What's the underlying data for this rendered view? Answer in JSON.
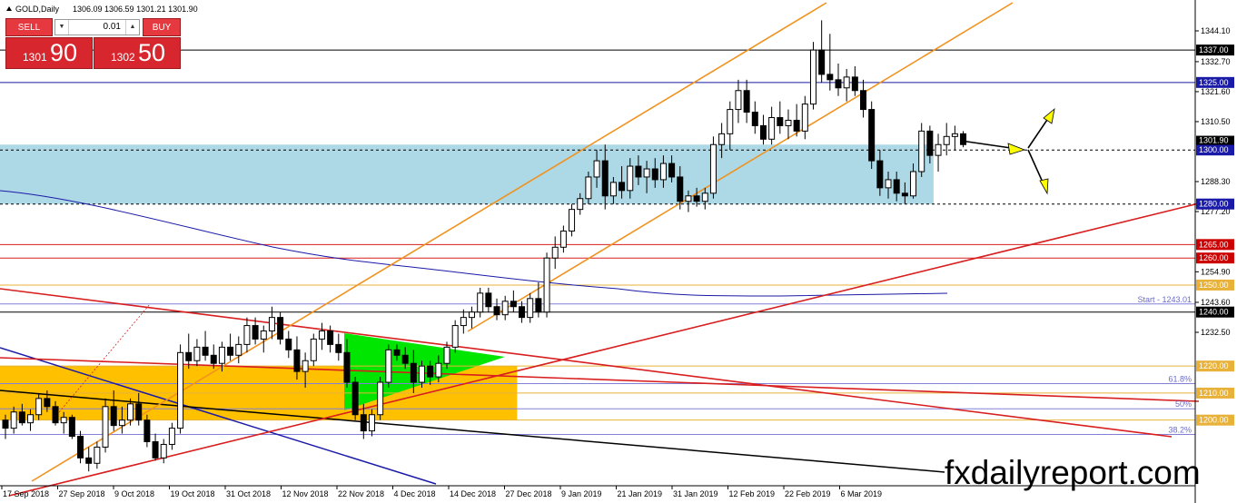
{
  "header": {
    "symbol_timeframe": "GOLD,Daily",
    "ohlc": "1306.09 1306.59 1301.21 1301.90"
  },
  "trade_panel": {
    "sell_label": "SELL",
    "buy_label": "BUY",
    "lot_size": "0.01",
    "sell_price_small": "1301",
    "sell_price_big": "90",
    "buy_price_small": "1302",
    "buy_price_big": "50",
    "button_color": "#e6393f"
  },
  "watermark": "fxdailyreport.com",
  "chart_data": {
    "type": "candlestick",
    "ylim": [
      1190,
      1350
    ],
    "y_ticks": [
      {
        "value": 1344.1,
        "label": "1344.10"
      },
      {
        "value": 1332.7,
        "label": "1332.70"
      },
      {
        "value": 1321.6,
        "label": "1321.60"
      },
      {
        "value": 1310.5,
        "label": "1310.50"
      },
      {
        "value": 1288.3,
        "label": "1288.30"
      },
      {
        "value": 1277.2,
        "label": "1277.20"
      },
      {
        "value": 1254.9,
        "label": "1254.90"
      },
      {
        "value": 1243.6,
        "label": "1243.60"
      },
      {
        "value": 1232.5,
        "label": "1232.50"
      }
    ],
    "x_ticks": [
      "17 Sep 2018",
      "27 Sep 2018",
      "9 Oct 2018",
      "19 Oct 2018",
      "31 Oct 2018",
      "12 Nov 2018",
      "22 Nov 2018",
      "4 Dec 2018",
      "14 Dec 2018",
      "27 Dec 2018",
      "9 Jan 2019",
      "21 Jan 2019",
      "31 Jan 2019",
      "12 Feb 2019",
      "22 Feb 2019",
      "6 Mar 2019"
    ],
    "level_lines": [
      {
        "price": 1337.0,
        "label": "1337.00",
        "style": "solid",
        "color": "#000000",
        "label_bg": "#000000"
      },
      {
        "price": 1325.0,
        "label": "1325.00",
        "style": "solid",
        "color": "#1a1aa8",
        "label_bg": "#1a1aa8"
      },
      {
        "price": 1300.0,
        "label": "1300.00",
        "style": "dashed",
        "color": "#000000",
        "label_bg": "#1a1aa8"
      },
      {
        "price": 1280.0,
        "label": "1280.00",
        "style": "dashed",
        "color": "#000000",
        "label_bg": "#1a1aa8"
      },
      {
        "price": 1265.0,
        "label": "1265.00",
        "style": "solid",
        "color": "#d81e1e",
        "label_bg": "#cc0000"
      },
      {
        "price": 1260.0,
        "label": "1260.00",
        "style": "solid",
        "color": "#d81e1e",
        "label_bg": "#cc0000"
      },
      {
        "price": 1250.0,
        "label": "1250.00",
        "style": "solid",
        "color": "#e8b23a",
        "label_bg": "#e8b23a"
      },
      {
        "price": 1240.0,
        "label": "1240.00",
        "style": "solid",
        "color": "#000000",
        "label_bg": "#000000"
      },
      {
        "price": 1220.0,
        "label": "1220.00",
        "style": "solid",
        "color": "#e8b23a",
        "label_bg": "#e8b23a"
      },
      {
        "price": 1210.0,
        "label": "1210.00",
        "style": "solid",
        "color": "#e8b23a",
        "label_bg": "#e8b23a"
      },
      {
        "price": 1200.0,
        "label": "1200.00",
        "style": "solid",
        "color": "#e8b23a",
        "label_bg": "#e8b23a"
      }
    ],
    "fib_labels": [
      {
        "price": 1243.0,
        "label": "Start - 1243.01"
      },
      {
        "price": 1213.5,
        "label": "61.8%"
      },
      {
        "price": 1204.2,
        "label": "50%"
      },
      {
        "price": 1194.7,
        "label": "38.2%"
      }
    ],
    "current_price": {
      "value": 1301.9,
      "label": "1301.90"
    },
    "zones": [
      {
        "color": "#add8e6",
        "x_start": 0,
        "x_end": 111,
        "y_low": 1280,
        "y_high": 1302
      },
      {
        "color": "#ffc000",
        "x_start": 0,
        "x_end": 61,
        "y_low": 1200,
        "y_high": 1220
      }
    ],
    "candles": [
      [
        1200,
        1202,
        1193,
        1197
      ],
      [
        1197,
        1205,
        1195,
        1203
      ],
      [
        1203,
        1206,
        1198,
        1199
      ],
      [
        1199,
        1204,
        1196,
        1202
      ],
      [
        1202,
        1210,
        1200,
        1208
      ],
      [
        1208,
        1211,
        1203,
        1205
      ],
      [
        1205,
        1207,
        1198,
        1199
      ],
      [
        1199,
        1203,
        1195,
        1201
      ],
      [
        1201,
        1202,
        1193,
        1194
      ],
      [
        1194,
        1196,
        1184,
        1186
      ],
      [
        1186,
        1190,
        1181,
        1184
      ],
      [
        1184,
        1192,
        1182,
        1190
      ],
      [
        1190,
        1208,
        1188,
        1205
      ],
      [
        1205,
        1211,
        1196,
        1198
      ],
      [
        1198,
        1205,
        1195,
        1200
      ],
      [
        1200,
        1208,
        1198,
        1206
      ],
      [
        1206,
        1210,
        1198,
        1200
      ],
      [
        1200,
        1202,
        1190,
        1192
      ],
      [
        1192,
        1195,
        1185,
        1186
      ],
      [
        1186,
        1193,
        1184,
        1191
      ],
      [
        1191,
        1199,
        1189,
        1197
      ],
      [
        1197,
        1228,
        1195,
        1225
      ],
      [
        1225,
        1232,
        1219,
        1222
      ],
      [
        1222,
        1230,
        1220,
        1227
      ],
      [
        1227,
        1233,
        1222,
        1224
      ],
      [
        1224,
        1228,
        1219,
        1221
      ],
      [
        1221,
        1229,
        1218,
        1227
      ],
      [
        1227,
        1232,
        1222,
        1224
      ],
      [
        1224,
        1231,
        1221,
        1228
      ],
      [
        1228,
        1238,
        1225,
        1235
      ],
      [
        1235,
        1238,
        1228,
        1230
      ],
      [
        1230,
        1235,
        1225,
        1233
      ],
      [
        1233,
        1242,
        1230,
        1238
      ],
      [
        1238,
        1240,
        1228,
        1230
      ],
      [
        1230,
        1233,
        1223,
        1226
      ],
      [
        1226,
        1231,
        1215,
        1218
      ],
      [
        1218,
        1225,
        1212,
        1222
      ],
      [
        1222,
        1232,
        1220,
        1230
      ],
      [
        1230,
        1236,
        1226,
        1233
      ],
      [
        1233,
        1235,
        1225,
        1228
      ],
      [
        1228,
        1232,
        1222,
        1225
      ],
      [
        1225,
        1230,
        1212,
        1214
      ],
      [
        1214,
        1216,
        1200,
        1202
      ],
      [
        1202,
        1206,
        1193,
        1196
      ],
      [
        1196,
        1204,
        1194,
        1202
      ],
      [
        1202,
        1216,
        1200,
        1214
      ],
      [
        1214,
        1228,
        1212,
        1226
      ],
      [
        1226,
        1228,
        1222,
        1224
      ],
      [
        1224,
        1227,
        1219,
        1221
      ],
      [
        1221,
        1226,
        1210,
        1214
      ],
      [
        1214,
        1222,
        1212,
        1220
      ],
      [
        1220,
        1222,
        1213,
        1216
      ],
      [
        1216,
        1224,
        1214,
        1221
      ],
      [
        1221,
        1229,
        1219,
        1227
      ],
      [
        1227,
        1237,
        1225,
        1235
      ],
      [
        1235,
        1241,
        1232,
        1238
      ],
      [
        1238,
        1242,
        1234,
        1240
      ],
      [
        1240,
        1249,
        1238,
        1247
      ],
      [
        1247,
        1249,
        1240,
        1242
      ],
      [
        1242,
        1245,
        1237,
        1239
      ],
      [
        1239,
        1246,
        1237,
        1244
      ],
      [
        1244,
        1248,
        1240,
        1242
      ],
      [
        1242,
        1244,
        1236,
        1238
      ],
      [
        1238,
        1247,
        1236,
        1245
      ],
      [
        1245,
        1251,
        1238,
        1240
      ],
      [
        1240,
        1262,
        1238,
        1260
      ],
      [
        1260,
        1268,
        1256,
        1264
      ],
      [
        1264,
        1272,
        1262,
        1270
      ],
      [
        1270,
        1280,
        1268,
        1278
      ],
      [
        1278,
        1284,
        1276,
        1282
      ],
      [
        1282,
        1292,
        1280,
        1290
      ],
      [
        1290,
        1300,
        1286,
        1296
      ],
      [
        1296,
        1302,
        1278,
        1283
      ],
      [
        1283,
        1290,
        1280,
        1288
      ],
      [
        1288,
        1294,
        1282,
        1285
      ],
      [
        1285,
        1297,
        1282,
        1294
      ],
      [
        1294,
        1298,
        1287,
        1290
      ],
      [
        1290,
        1296,
        1284,
        1293
      ],
      [
        1293,
        1297,
        1286,
        1289
      ],
      [
        1289,
        1298,
        1286,
        1295
      ],
      [
        1295,
        1298,
        1288,
        1290
      ],
      [
        1290,
        1294,
        1278,
        1281
      ],
      [
        1281,
        1285,
        1277,
        1283
      ],
      [
        1283,
        1286,
        1279,
        1281
      ],
      [
        1281,
        1286,
        1278,
        1284
      ],
      [
        1284,
        1305,
        1282,
        1302
      ],
      [
        1302,
        1310,
        1297,
        1306
      ],
      [
        1306,
        1318,
        1300,
        1315
      ],
      [
        1315,
        1326,
        1310,
        1322
      ],
      [
        1322,
        1326,
        1310,
        1314
      ],
      [
        1314,
        1318,
        1306,
        1309
      ],
      [
        1309,
        1313,
        1302,
        1304
      ],
      [
        1304,
        1316,
        1302,
        1312
      ],
      [
        1312,
        1318,
        1306,
        1309
      ],
      [
        1309,
        1315,
        1304,
        1311
      ],
      [
        1311,
        1317,
        1305,
        1307
      ],
      [
        1307,
        1320,
        1304,
        1317
      ],
      [
        1317,
        1340,
        1315,
        1337
      ],
      [
        1337,
        1348,
        1325,
        1328
      ],
      [
        1328,
        1343,
        1322,
        1326
      ],
      [
        1326,
        1332,
        1320,
        1323
      ],
      [
        1323,
        1330,
        1318,
        1327
      ],
      [
        1327,
        1331,
        1320,
        1322
      ],
      [
        1322,
        1326,
        1312,
        1315
      ],
      [
        1315,
        1318,
        1293,
        1296
      ],
      [
        1296,
        1300,
        1283,
        1286
      ],
      [
        1286,
        1292,
        1282,
        1289
      ],
      [
        1289,
        1292,
        1281,
        1284
      ],
      [
        1284,
        1288,
        1280,
        1283
      ],
      [
        1283,
        1295,
        1282,
        1292
      ],
      [
        1292,
        1310,
        1290,
        1307
      ],
      [
        1307,
        1309,
        1295,
        1298
      ],
      [
        1298,
        1306,
        1292,
        1302
      ],
      [
        1302,
        1310,
        1298,
        1305
      ],
      [
        1305,
        1309,
        1300,
        1306
      ],
      [
        1306,
        1307,
        1301,
        1302
      ]
    ]
  }
}
